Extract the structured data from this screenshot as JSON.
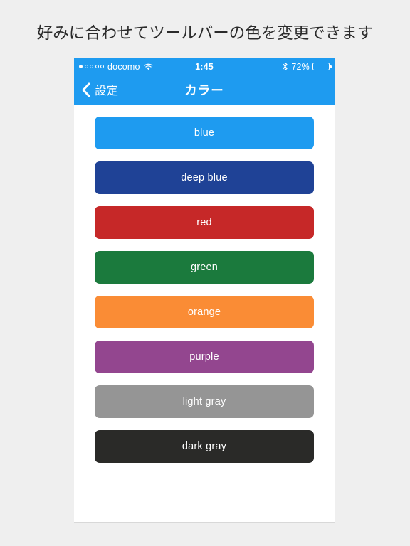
{
  "caption": "好みに合わせてツールバーの色を変更できます",
  "theme": {
    "page_background": "#efefef",
    "panel_background": "#ffffff",
    "toolbar_color": "#1e9bf0",
    "caption_text_color": "#2b2b2b"
  },
  "status_bar": {
    "signal_dots": {
      "filled": 1,
      "total": 5
    },
    "carrier": "docomo",
    "wifi_icon": "wifi-icon",
    "time": "1:45",
    "bluetooth_icon": "bluetooth-icon",
    "battery_percent": "72%",
    "battery_level": 72,
    "battery_icon": "battery-icon"
  },
  "nav_bar": {
    "back_icon": "chevron-left-icon",
    "back_label": "設定",
    "title": "カラー"
  },
  "colors": [
    {
      "label": "blue",
      "hex": "#1e9bf0",
      "text_color": "#ffffff"
    },
    {
      "label": "deep blue",
      "hex": "#1f4296",
      "text_color": "#ffffff"
    },
    {
      "label": "red",
      "hex": "#c62828",
      "text_color": "#ffffff"
    },
    {
      "label": "green",
      "hex": "#1b7a3d",
      "text_color": "#ffffff"
    },
    {
      "label": "orange",
      "hex": "#fa8c35",
      "text_color": "#ffffff"
    },
    {
      "label": "purple",
      "hex": "#93468f",
      "text_color": "#ffffff"
    },
    {
      "label": "light gray",
      "hex": "#959595",
      "text_color": "#ffffff"
    },
    {
      "label": "dark gray",
      "hex": "#2a2a28",
      "text_color": "#ffffff"
    }
  ]
}
